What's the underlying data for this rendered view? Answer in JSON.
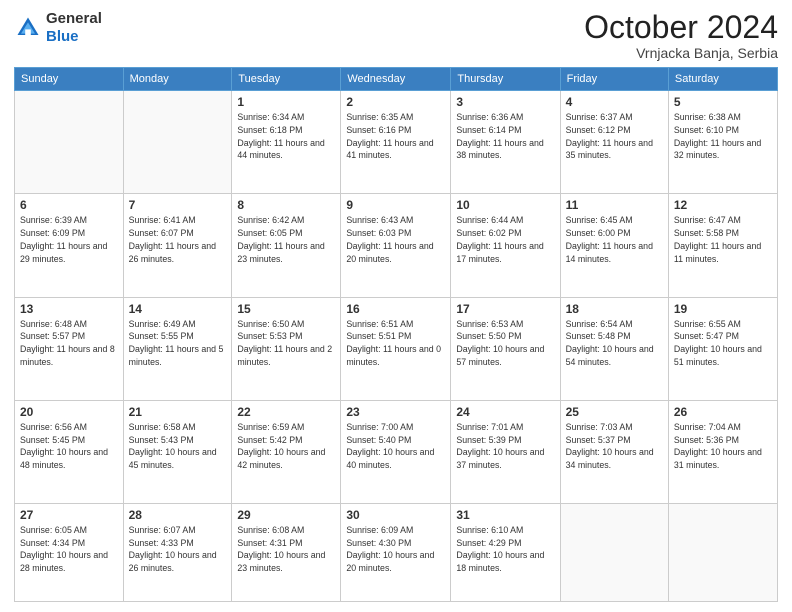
{
  "header": {
    "logo": {
      "line1": "General",
      "line2": "Blue"
    },
    "title": "October 2024",
    "subtitle": "Vrnjacka Banja, Serbia"
  },
  "days_of_week": [
    "Sunday",
    "Monday",
    "Tuesday",
    "Wednesday",
    "Thursday",
    "Friday",
    "Saturday"
  ],
  "weeks": [
    [
      {
        "day": "",
        "info": ""
      },
      {
        "day": "",
        "info": ""
      },
      {
        "day": "1",
        "info": "Sunrise: 6:34 AM\nSunset: 6:18 PM\nDaylight: 11 hours and 44 minutes."
      },
      {
        "day": "2",
        "info": "Sunrise: 6:35 AM\nSunset: 6:16 PM\nDaylight: 11 hours and 41 minutes."
      },
      {
        "day": "3",
        "info": "Sunrise: 6:36 AM\nSunset: 6:14 PM\nDaylight: 11 hours and 38 minutes."
      },
      {
        "day": "4",
        "info": "Sunrise: 6:37 AM\nSunset: 6:12 PM\nDaylight: 11 hours and 35 minutes."
      },
      {
        "day": "5",
        "info": "Sunrise: 6:38 AM\nSunset: 6:10 PM\nDaylight: 11 hours and 32 minutes."
      }
    ],
    [
      {
        "day": "6",
        "info": "Sunrise: 6:39 AM\nSunset: 6:09 PM\nDaylight: 11 hours and 29 minutes."
      },
      {
        "day": "7",
        "info": "Sunrise: 6:41 AM\nSunset: 6:07 PM\nDaylight: 11 hours and 26 minutes."
      },
      {
        "day": "8",
        "info": "Sunrise: 6:42 AM\nSunset: 6:05 PM\nDaylight: 11 hours and 23 minutes."
      },
      {
        "day": "9",
        "info": "Sunrise: 6:43 AM\nSunset: 6:03 PM\nDaylight: 11 hours and 20 minutes."
      },
      {
        "day": "10",
        "info": "Sunrise: 6:44 AM\nSunset: 6:02 PM\nDaylight: 11 hours and 17 minutes."
      },
      {
        "day": "11",
        "info": "Sunrise: 6:45 AM\nSunset: 6:00 PM\nDaylight: 11 hours and 14 minutes."
      },
      {
        "day": "12",
        "info": "Sunrise: 6:47 AM\nSunset: 5:58 PM\nDaylight: 11 hours and 11 minutes."
      }
    ],
    [
      {
        "day": "13",
        "info": "Sunrise: 6:48 AM\nSunset: 5:57 PM\nDaylight: 11 hours and 8 minutes."
      },
      {
        "day": "14",
        "info": "Sunrise: 6:49 AM\nSunset: 5:55 PM\nDaylight: 11 hours and 5 minutes."
      },
      {
        "day": "15",
        "info": "Sunrise: 6:50 AM\nSunset: 5:53 PM\nDaylight: 11 hours and 2 minutes."
      },
      {
        "day": "16",
        "info": "Sunrise: 6:51 AM\nSunset: 5:51 PM\nDaylight: 11 hours and 0 minutes."
      },
      {
        "day": "17",
        "info": "Sunrise: 6:53 AM\nSunset: 5:50 PM\nDaylight: 10 hours and 57 minutes."
      },
      {
        "day": "18",
        "info": "Sunrise: 6:54 AM\nSunset: 5:48 PM\nDaylight: 10 hours and 54 minutes."
      },
      {
        "day": "19",
        "info": "Sunrise: 6:55 AM\nSunset: 5:47 PM\nDaylight: 10 hours and 51 minutes."
      }
    ],
    [
      {
        "day": "20",
        "info": "Sunrise: 6:56 AM\nSunset: 5:45 PM\nDaylight: 10 hours and 48 minutes."
      },
      {
        "day": "21",
        "info": "Sunrise: 6:58 AM\nSunset: 5:43 PM\nDaylight: 10 hours and 45 minutes."
      },
      {
        "day": "22",
        "info": "Sunrise: 6:59 AM\nSunset: 5:42 PM\nDaylight: 10 hours and 42 minutes."
      },
      {
        "day": "23",
        "info": "Sunrise: 7:00 AM\nSunset: 5:40 PM\nDaylight: 10 hours and 40 minutes."
      },
      {
        "day": "24",
        "info": "Sunrise: 7:01 AM\nSunset: 5:39 PM\nDaylight: 10 hours and 37 minutes."
      },
      {
        "day": "25",
        "info": "Sunrise: 7:03 AM\nSunset: 5:37 PM\nDaylight: 10 hours and 34 minutes."
      },
      {
        "day": "26",
        "info": "Sunrise: 7:04 AM\nSunset: 5:36 PM\nDaylight: 10 hours and 31 minutes."
      }
    ],
    [
      {
        "day": "27",
        "info": "Sunrise: 6:05 AM\nSunset: 4:34 PM\nDaylight: 10 hours and 28 minutes."
      },
      {
        "day": "28",
        "info": "Sunrise: 6:07 AM\nSunset: 4:33 PM\nDaylight: 10 hours and 26 minutes."
      },
      {
        "day": "29",
        "info": "Sunrise: 6:08 AM\nSunset: 4:31 PM\nDaylight: 10 hours and 23 minutes."
      },
      {
        "day": "30",
        "info": "Sunrise: 6:09 AM\nSunset: 4:30 PM\nDaylight: 10 hours and 20 minutes."
      },
      {
        "day": "31",
        "info": "Sunrise: 6:10 AM\nSunset: 4:29 PM\nDaylight: 10 hours and 18 minutes."
      },
      {
        "day": "",
        "info": ""
      },
      {
        "day": "",
        "info": ""
      }
    ]
  ]
}
